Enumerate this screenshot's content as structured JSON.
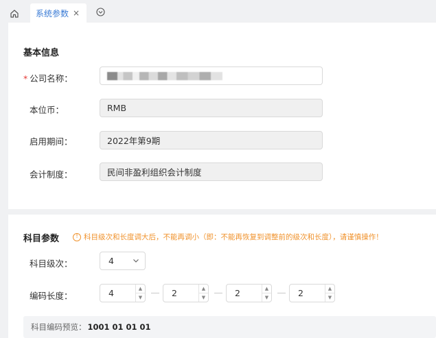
{
  "tabs": {
    "home_icon": "home-icon",
    "active_label": "系统参数",
    "close_glyph": "×",
    "more_icon": "chevron-down-circle-icon"
  },
  "basic": {
    "title": "基本信息",
    "required_mark": "*",
    "company_label": "公司名称：",
    "company_value_blurred": true,
    "currency_label": "本位币：",
    "currency_value": "RMB",
    "period_label": "启用期间：",
    "period_value": "2022年第9期",
    "system_label": "会计制度：",
    "system_value": "民间非盈利组织会计制度"
  },
  "subject": {
    "title": "科目参数",
    "warning_icon": "!",
    "warning": "科目级次和长度调大后，不能再调小（即：不能再恢复到调整前的级次和长度），请谨慎操作！",
    "level_label": "科目级次：",
    "level_value": "4",
    "length_label": "编码长度：",
    "lengths": [
      "4",
      "2",
      "2",
      "2"
    ],
    "preview_label": "科目编码预览：",
    "preview_value": "1001 01 01 01"
  },
  "colors": {
    "accent": "#3a7bd5",
    "warning": "#f0932e",
    "required": "#e53935"
  }
}
